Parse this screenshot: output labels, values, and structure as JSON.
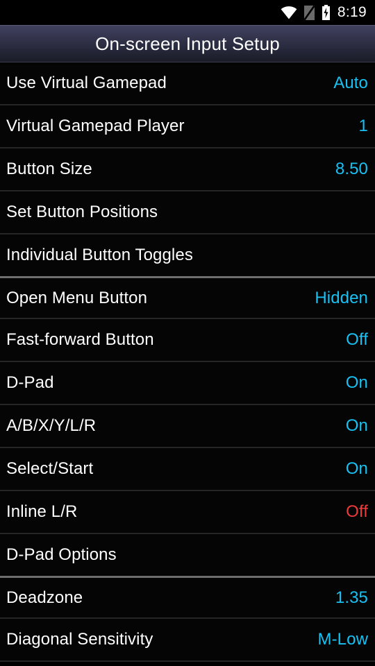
{
  "statusbar": {
    "icons": [
      {
        "name": "wifi-icon"
      },
      {
        "name": "no-sim-icon"
      },
      {
        "name": "battery-charging-icon"
      }
    ],
    "time": "8:19"
  },
  "titlebar": {
    "title": "On-screen Input Setup"
  },
  "colors": {
    "accent": "#17c1f3",
    "warning": "#f03a3a",
    "label": "#ffffff",
    "row_bg": "#050505",
    "divider": "#262626",
    "section_divider": "#6e6e6e",
    "titlebar_top": "#41425f",
    "titlebar_bottom": "#1b1c27"
  },
  "list": {
    "rows": [
      {
        "label": "Use Virtual Gamepad",
        "value": "Auto",
        "value_style": "accent",
        "section_start": false
      },
      {
        "label": "Virtual Gamepad Player",
        "value": "1",
        "value_style": "accent",
        "section_start": false
      },
      {
        "label": "Button Size",
        "value": "8.50",
        "value_style": "accent",
        "section_start": false
      },
      {
        "label": "Set Button Positions",
        "value": "",
        "value_style": "none",
        "section_start": false
      },
      {
        "label": "Individual Button Toggles",
        "value": "",
        "value_style": "none",
        "section_start": false
      },
      {
        "label": "Open Menu Button",
        "value": "Hidden",
        "value_style": "accent",
        "section_start": true
      },
      {
        "label": "Fast-forward Button",
        "value": "Off",
        "value_style": "accent",
        "section_start": false
      },
      {
        "label": "D-Pad",
        "value": "On",
        "value_style": "accent",
        "section_start": false
      },
      {
        "label": "A/B/X/Y/L/R",
        "value": "On",
        "value_style": "accent",
        "section_start": false
      },
      {
        "label": "Select/Start",
        "value": "On",
        "value_style": "accent",
        "section_start": false
      },
      {
        "label": "Inline L/R",
        "value": "Off",
        "value_style": "warning",
        "section_start": false
      },
      {
        "label": "D-Pad Options",
        "value": "",
        "value_style": "none",
        "section_start": false
      },
      {
        "label": "Deadzone",
        "value": "1.35",
        "value_style": "accent",
        "section_start": true
      },
      {
        "label": "Diagonal Sensitivity",
        "value": "M-Low",
        "value_style": "accent",
        "section_start": false
      }
    ]
  }
}
